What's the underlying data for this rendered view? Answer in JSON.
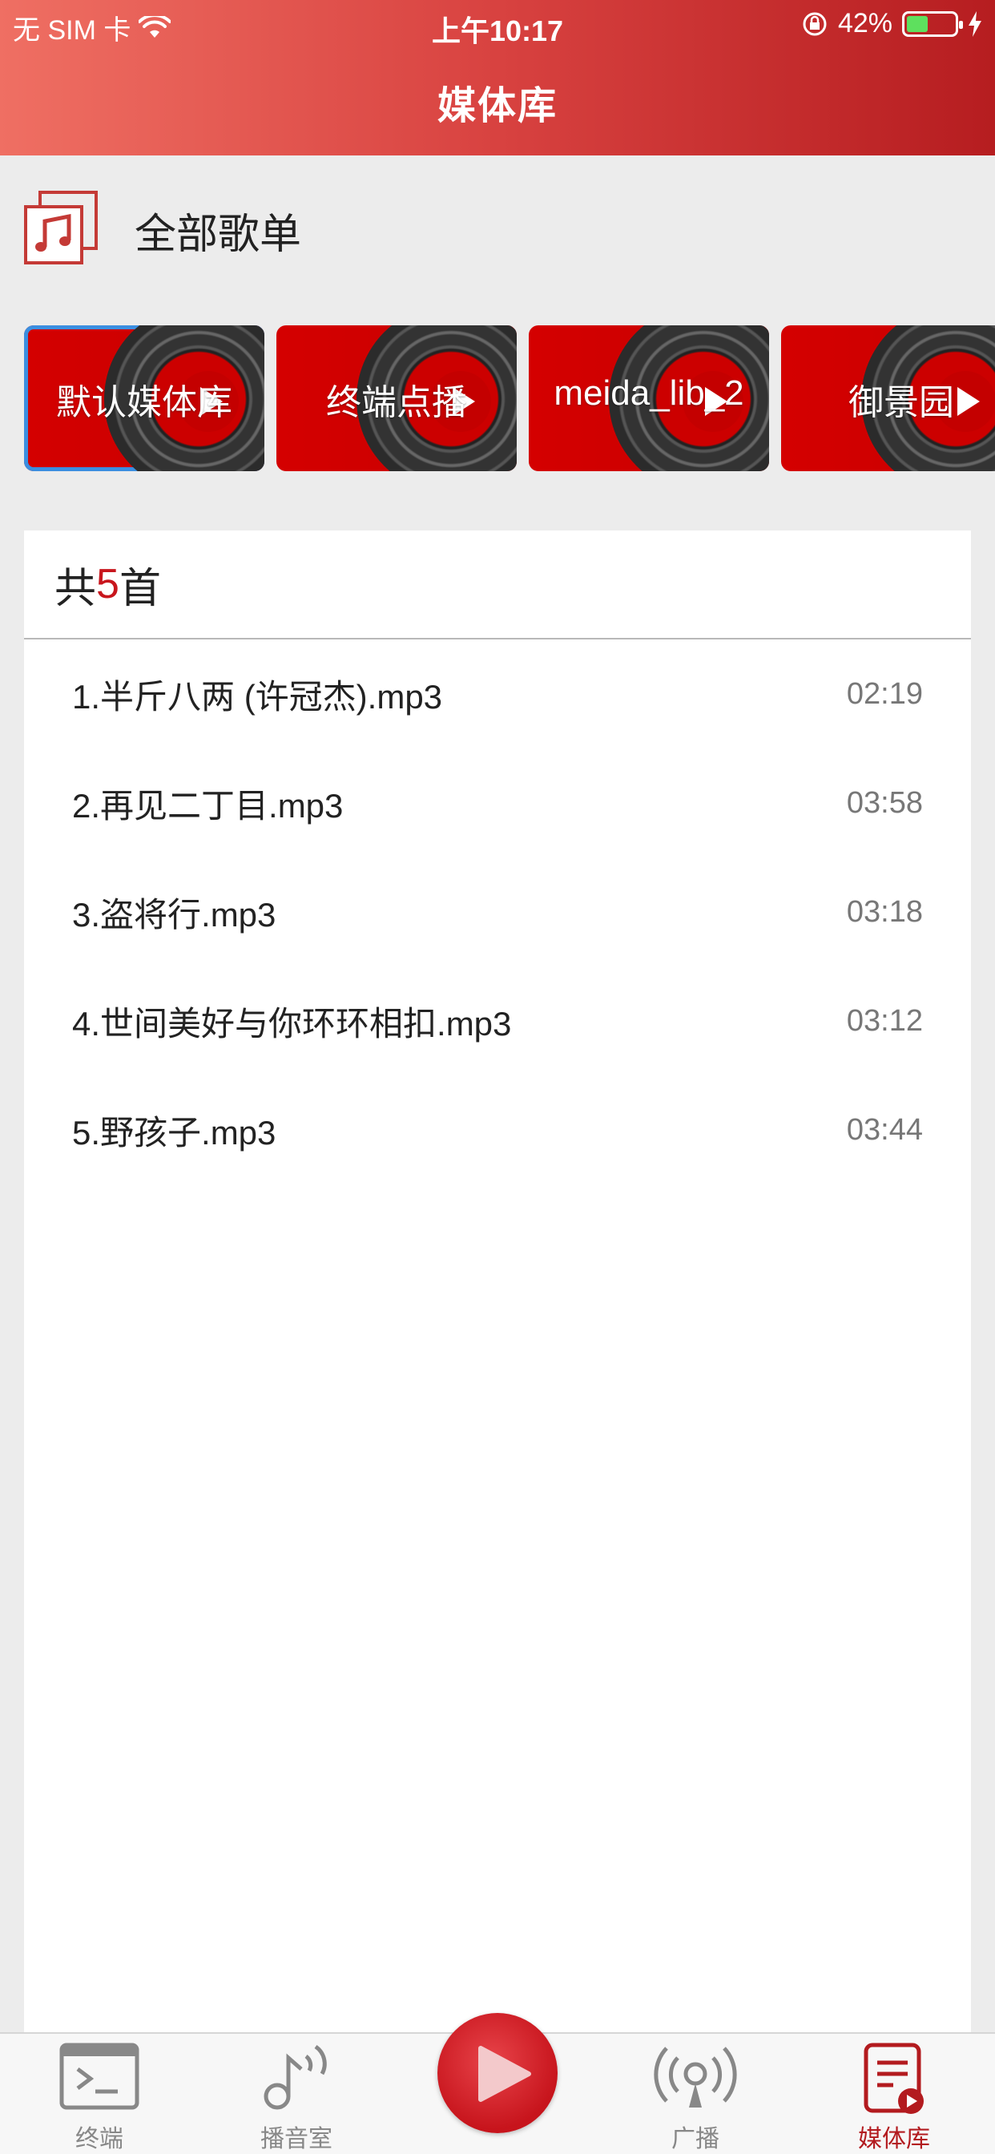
{
  "status": {
    "carrier": "无 SIM 卡",
    "time": "上午10:17",
    "battery": "42%",
    "battery_level": 0.42
  },
  "header": {
    "title": "媒体库"
  },
  "all_playlists": {
    "label": "全部歌单",
    "icon": "music-note-icon"
  },
  "libraries": [
    {
      "label": "默认媒体库",
      "selected": true
    },
    {
      "label": "终端点播",
      "selected": false
    },
    {
      "label": "meida_lib_2",
      "selected": false
    },
    {
      "label": "御景园",
      "selected": false
    }
  ],
  "song_panel": {
    "count_prefix": "共",
    "count": "5",
    "count_suffix": "首",
    "songs": [
      {
        "title": "1.半斤八两 (许冠杰).mp3",
        "duration": "02:19"
      },
      {
        "title": "2.再见二丁目.mp3",
        "duration": "03:58"
      },
      {
        "title": "3.盗将行.mp3",
        "duration": "03:18"
      },
      {
        "title": "4.世间美好与你环环相扣.mp3",
        "duration": "03:12"
      },
      {
        "title": "5.野孩子.mp3",
        "duration": "03:44"
      }
    ]
  },
  "tabbar": {
    "tabs": [
      {
        "label": "终端",
        "icon": "terminal-icon",
        "active": false
      },
      {
        "label": "播音室",
        "icon": "music-broadcast-icon",
        "active": false
      },
      {
        "label": "广播",
        "icon": "broadcast-icon",
        "active": false
      },
      {
        "label": "媒体库",
        "icon": "media-library-icon",
        "active": true
      }
    ],
    "center_button": "play-icon"
  },
  "colors": {
    "accent": "#c8161d",
    "selected_border": "#3b8ee0",
    "header_start": "#ef6f63",
    "header_end": "#b61d20"
  }
}
